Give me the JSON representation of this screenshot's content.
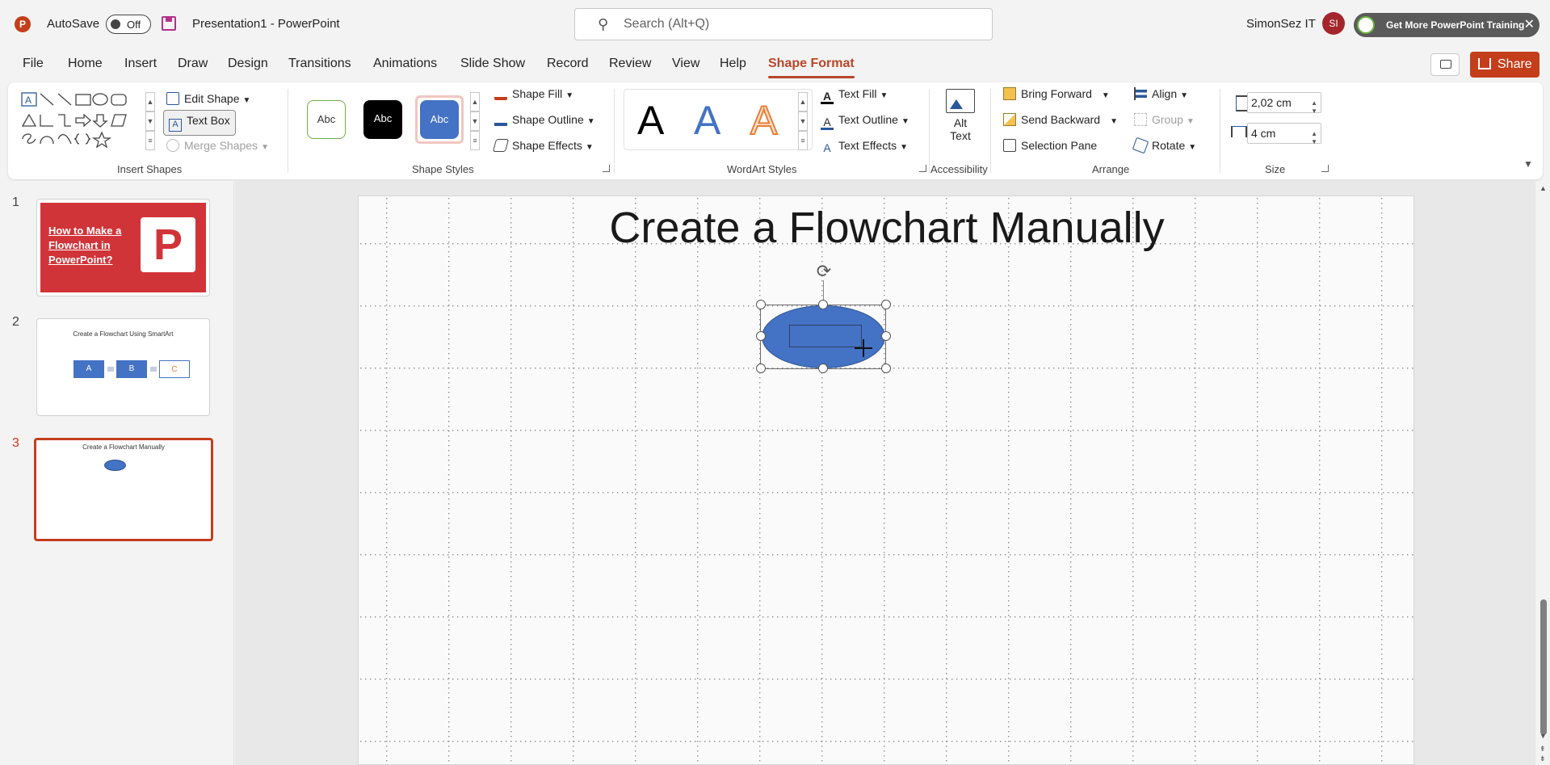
{
  "titlebar": {
    "app_logo": "P",
    "autosave_label": "AutoSave",
    "autosave_state": "Off",
    "doc_title": "Presentation1  -  PowerPoint",
    "search_placeholder": "Search (Alt+Q)",
    "username": "SimonSez IT",
    "avatar_initials": "SI",
    "promo_text": "Get More PowerPoint Training",
    "promo_close": "✕"
  },
  "menu": {
    "tabs": [
      "File",
      "Home",
      "Insert",
      "Draw",
      "Design",
      "Transitions",
      "Animations",
      "Slide Show",
      "Record",
      "Review",
      "View",
      "Help",
      "Shape Format"
    ],
    "active_tab": "Shape Format",
    "share_label": "Share"
  },
  "ribbon": {
    "insert_shapes": {
      "label": "Insert Shapes",
      "edit_shape": "Edit Shape",
      "text_box": "Text Box",
      "merge_shapes": "Merge Shapes"
    },
    "shape_styles": {
      "label": "Shape Styles",
      "swatch_text": "Abc",
      "shape_fill": "Shape Fill",
      "shape_outline": "Shape Outline",
      "shape_effects": "Shape Effects"
    },
    "wordart": {
      "label": "WordArt Styles",
      "sample": "A",
      "text_fill": "Text Fill",
      "text_outline": "Text Outline",
      "text_effects": "Text Effects"
    },
    "accessibility": {
      "label": "Accessibility",
      "alt_text_line1": "Alt",
      "alt_text_line2": "Text"
    },
    "arrange": {
      "label": "Arrange",
      "bring_forward": "Bring Forward",
      "send_backward": "Send Backward",
      "selection_pane": "Selection Pane",
      "align": "Align",
      "group": "Group",
      "rotate": "Rotate"
    },
    "size": {
      "label": "Size",
      "height": "2,02 cm",
      "width": "4 cm"
    }
  },
  "thumbnails": {
    "items": [
      {
        "num": "1",
        "title": "How to Make a Flowchart in PowerPoint?"
      },
      {
        "num": "2",
        "title": "Create a Flowchart Using SmartArt",
        "boxes": [
          "A",
          "B",
          "C"
        ]
      },
      {
        "num": "3",
        "title": "Create a Flowchart Manually"
      }
    ],
    "active": "3"
  },
  "slide": {
    "title": "Create a Flowchart Manually"
  },
  "colors": {
    "accent": "#b7472a",
    "share": "#c43e1c",
    "shape_fill": "#4472c4",
    "shape_outline": "#2f528f"
  }
}
